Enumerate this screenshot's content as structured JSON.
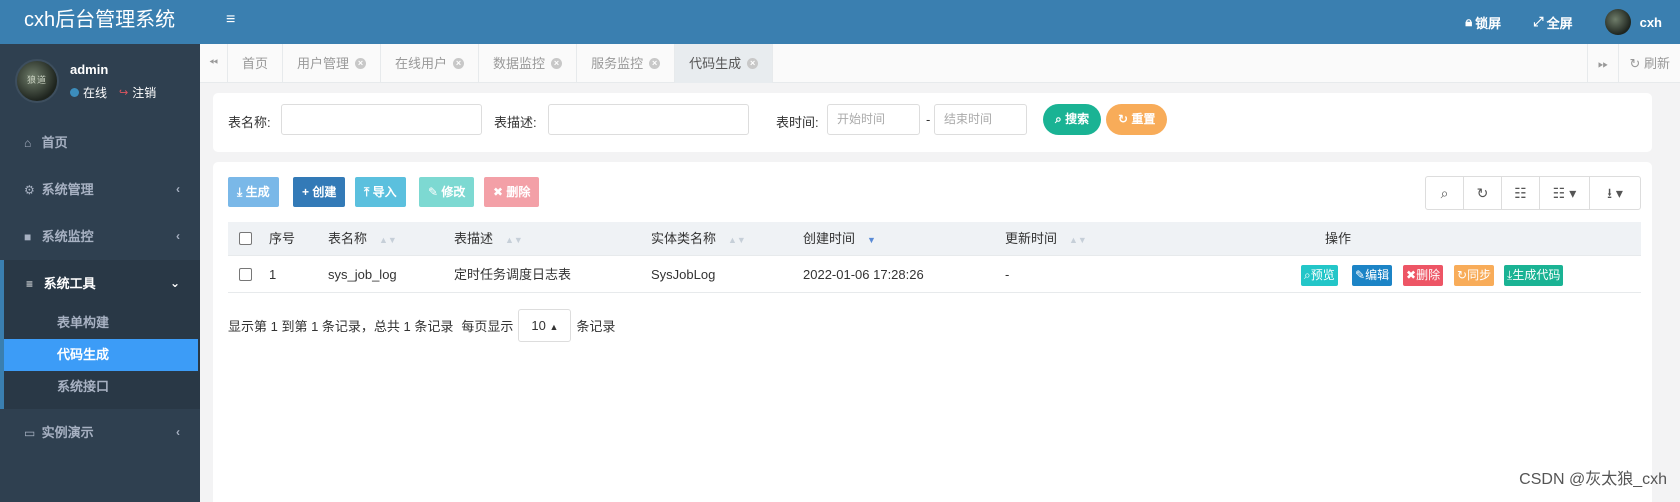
{
  "app": {
    "title": "cxh后台管理系统"
  },
  "user": {
    "name": "admin",
    "status": "在线",
    "logout": "注销",
    "avatar_text": "狼道",
    "top_name": "cxh"
  },
  "topbar": {
    "lock": "锁屏",
    "fullscreen": "全屏"
  },
  "sidebar": {
    "items": [
      {
        "label": "首页",
        "icon": "home-icon"
      },
      {
        "label": "系统管理",
        "icon": "gear-icon"
      },
      {
        "label": "系统监控",
        "icon": "video-icon"
      },
      {
        "label": "系统工具",
        "icon": "bars-icon",
        "expanded": true
      },
      {
        "label": "实例演示",
        "icon": "desktop-icon"
      }
    ],
    "subitems": [
      {
        "label": "表单构建"
      },
      {
        "label": "代码生成",
        "active": true
      },
      {
        "label": "系统接口"
      }
    ]
  },
  "tabs": {
    "items": [
      {
        "label": "首页",
        "closable": false
      },
      {
        "label": "用户管理",
        "closable": true
      },
      {
        "label": "在线用户",
        "closable": true
      },
      {
        "label": "数据监控",
        "closable": true
      },
      {
        "label": "服务监控",
        "closable": true
      },
      {
        "label": "代码生成",
        "closable": true,
        "active": true
      }
    ],
    "refresh": "刷新"
  },
  "search": {
    "table_name_label": "表名称:",
    "table_desc_label": "表描述:",
    "table_time_label": "表时间:",
    "start_placeholder": "开始时间",
    "end_placeholder": "结束时间",
    "dash": "-",
    "search_btn": "搜索",
    "reset_btn": "重置"
  },
  "toolbar": {
    "generate": "生成",
    "create": "创建",
    "import": "导入",
    "edit": "修改",
    "delete": "删除"
  },
  "table": {
    "columns": [
      "序号",
      "表名称",
      "表描述",
      "实体类名称",
      "创建时间",
      "更新时间",
      "操作"
    ],
    "rows": [
      {
        "index": "1",
        "table_name": "sys_job_log",
        "table_desc": "定时任务调度日志表",
        "class_name": "SysJobLog",
        "create_time": "2022-01-06 17:28:26",
        "update_time": "-"
      }
    ],
    "actions": {
      "preview": "预览",
      "edit": "编辑",
      "delete": "删除",
      "sync": "同步",
      "gen": "生成代码"
    }
  },
  "pager": {
    "summary": "显示第 1 到第 1 条记录，总共 1 条记录",
    "per_page_prefix": "每页显示",
    "page_size": "10",
    "per_page_suffix": "条记录"
  },
  "watermark": "CSDN @灰太狼_cxh",
  "colors": {
    "topbar": "#3a7fb0",
    "sidebar": "#2f4050",
    "active_sub": "#3c9cf7",
    "success": "#1ab394",
    "warning": "#f8ac59",
    "info": "#23c6c8",
    "primary": "#1c84c6",
    "danger": "#ed5565"
  }
}
